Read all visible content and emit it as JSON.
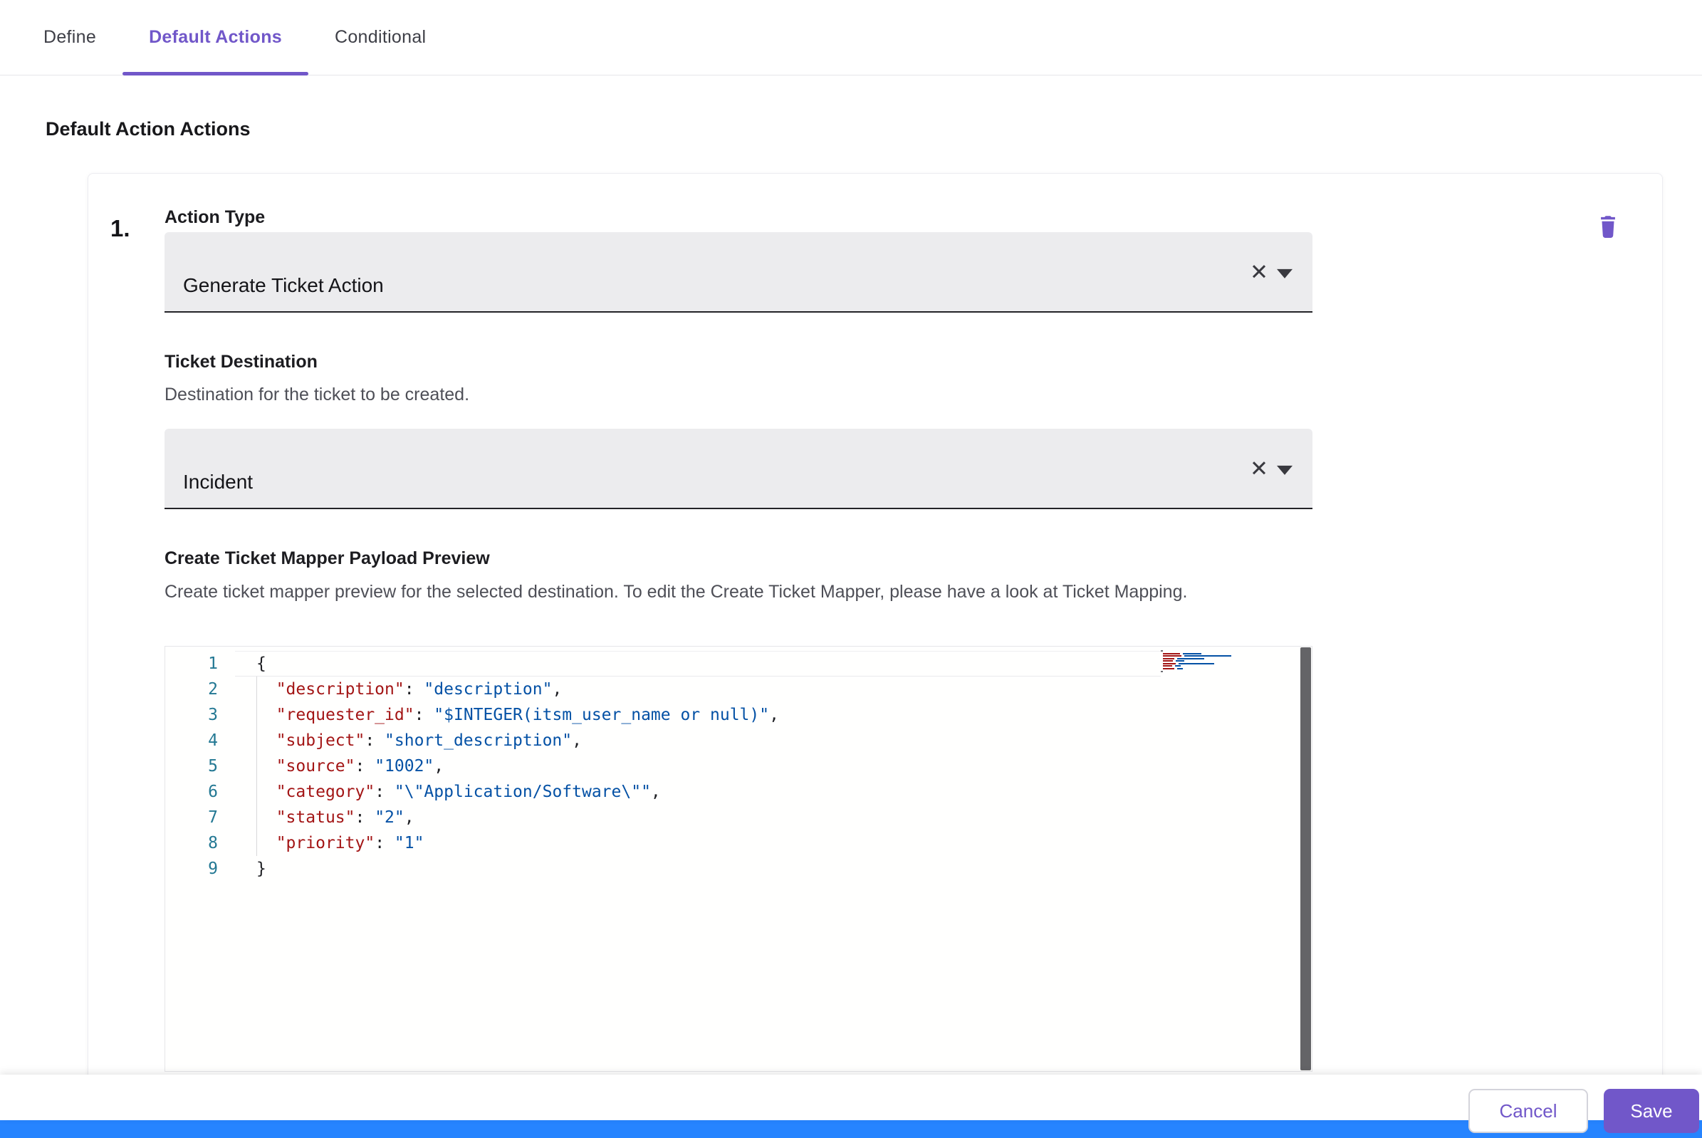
{
  "tabs": {
    "items": [
      {
        "label": "Define",
        "active": false
      },
      {
        "label": "Default Actions",
        "active": true
      },
      {
        "label": "Conditional",
        "active": false
      }
    ]
  },
  "page": {
    "heading": "Default Action Actions"
  },
  "action_card": {
    "index": "1.",
    "action_type": {
      "label": "Action Type",
      "value": "Generate Ticket Action"
    },
    "ticket_destination": {
      "label": "Ticket Destination",
      "help": "Destination for the ticket to be created.",
      "value": "Incident"
    },
    "payload_preview": {
      "label": "Create Ticket Mapper Payload Preview",
      "help": "Create ticket mapper preview for the selected destination. To edit the Create Ticket Mapper, please have a look at Ticket Mapping.",
      "code_lines": [
        "{",
        "  \"description\": \"description\",",
        "  \"requester_id\": \"$INTEGER(itsm_user_name or null)\",",
        "  \"subject\": \"short_description\",",
        "  \"source\": \"1002\",",
        "  \"category\": \"\\\"Application/Software\\\"\",",
        "  \"status\": \"2\",",
        "  \"priority\": \"1\"",
        "}"
      ]
    }
  },
  "footer": {
    "cancel_label": "Cancel",
    "save_label": "Save"
  },
  "icons": {
    "clear_glyph": "✕"
  },
  "colors": {
    "accent": "#7157C9",
    "key_token": "#A31515",
    "value_token": "#0451A5",
    "line_number": "#237893",
    "bottom_bar": "#2684FF",
    "select_bg": "#ECECEE"
  }
}
